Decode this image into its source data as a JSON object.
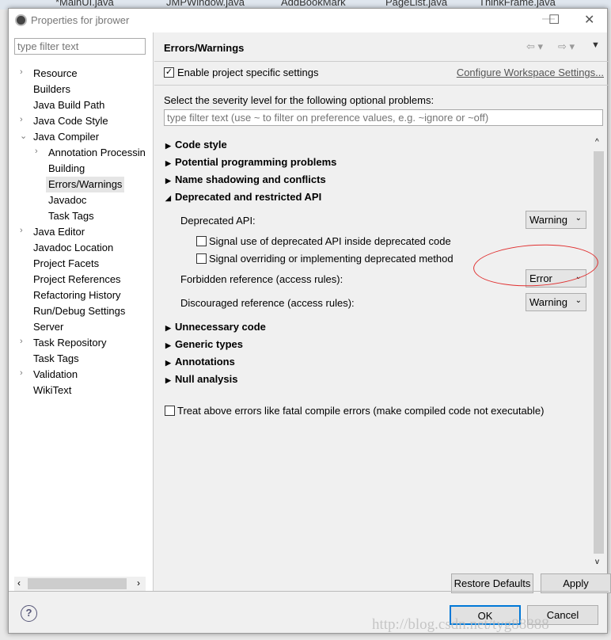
{
  "editor_tabs": [
    "*MainUI.java",
    "JMPWindow.java",
    "AddBookMark",
    "PageList.java",
    "ThinkFrame.java"
  ],
  "window": {
    "title": "Properties for jbrower",
    "minimize": "—",
    "maximize": "☐",
    "close": "✕"
  },
  "sidebar": {
    "filter_placeholder": "type filter text",
    "items": [
      {
        "label": "Resource",
        "twisty": "›",
        "indent": 0
      },
      {
        "label": "Builders",
        "indent": 0
      },
      {
        "label": "Java Build Path",
        "indent": 0
      },
      {
        "label": "Java Code Style",
        "twisty": "›",
        "indent": 0
      },
      {
        "label": "Java Compiler",
        "twisty": "⌄",
        "indent": 0
      },
      {
        "label": "Annotation Processin",
        "twisty": "›",
        "indent": 1
      },
      {
        "label": "Building",
        "indent": 1
      },
      {
        "label": "Errors/Warnings",
        "indent": 1,
        "selected": true
      },
      {
        "label": "Javadoc",
        "indent": 1
      },
      {
        "label": "Task Tags",
        "indent": 1
      },
      {
        "label": "Java Editor",
        "twisty": "›",
        "indent": 0
      },
      {
        "label": "Javadoc Location",
        "indent": 0
      },
      {
        "label": "Project Facets",
        "indent": 0
      },
      {
        "label": "Project References",
        "indent": 0
      },
      {
        "label": "Refactoring History",
        "indent": 0
      },
      {
        "label": "Run/Debug Settings",
        "indent": 0
      },
      {
        "label": "Server",
        "indent": 0
      },
      {
        "label": "Task Repository",
        "twisty": "›",
        "indent": 0
      },
      {
        "label": "Task Tags",
        "indent": 0
      },
      {
        "label": "Validation",
        "twisty": "›",
        "indent": 0
      },
      {
        "label": "WikiText",
        "indent": 0
      }
    ]
  },
  "main": {
    "title": "Errors/Warnings",
    "enable_label": "Enable project specific settings",
    "enable_checked": true,
    "configure_link": "Configure Workspace Settings...",
    "instruction": "Select the severity level for the following optional problems:",
    "filter_placeholder": "type filter text (use ~ to filter on preference values, e.g. ~ignore or ~off)",
    "sections_top": [
      "Code style",
      "Potential programming problems",
      "Name shadowing and conflicts"
    ],
    "expanded_section": "Deprecated and restricted API",
    "deprecated_api": {
      "label": "Deprecated API:",
      "value": "Warning"
    },
    "check1": "Signal use of deprecated API inside deprecated code",
    "check2": "Signal overriding or implementing deprecated method",
    "forbidden": {
      "label": "Forbidden reference (access rules):",
      "value": "Error"
    },
    "discouraged": {
      "label": "Discouraged reference (access rules):",
      "value": "Warning"
    },
    "sections_bottom": [
      "Unnecessary code",
      "Generic types",
      "Annotations",
      "Null analysis"
    ],
    "fatal_label": "Treat above errors like fatal compile errors (make compiled code not executable)",
    "restore_defaults": "Restore Defaults",
    "apply": "Apply"
  },
  "footer": {
    "ok": "OK",
    "cancel": "Cancel"
  },
  "watermark": "http://blog.csdn.net/tyg88888",
  "annotation_color": "#e03030"
}
